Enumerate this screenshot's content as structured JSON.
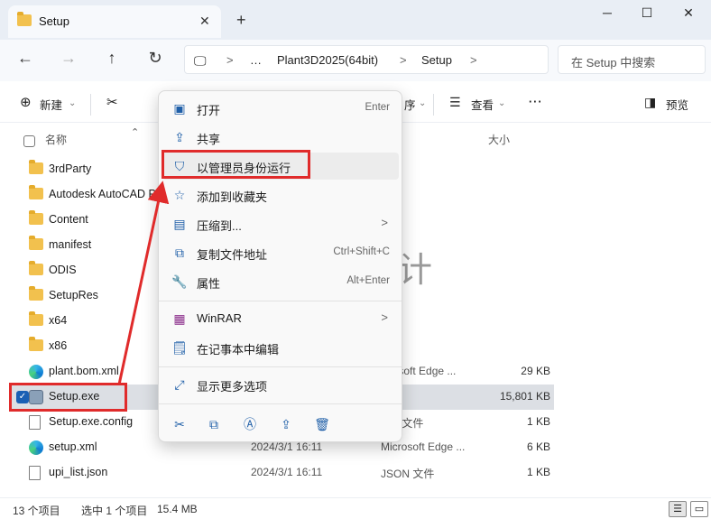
{
  "window": {
    "tab_title": "Setup",
    "new_tab": "+",
    "minimize": "─",
    "maximize": "☐",
    "close": "✕"
  },
  "address": {
    "parts": [
      "…",
      "Plant3D2025(64bit)",
      "Setup"
    ],
    "separator": ">",
    "search_placeholder": "在 Setup 中搜索"
  },
  "toolbar": {
    "new_label": "新建",
    "sort_label": "序",
    "view_label": "查看",
    "more_label": "···",
    "preview_label": "预览"
  },
  "columns": {
    "name": "名称",
    "size": "大小"
  },
  "files": [
    {
      "name": "3rdParty",
      "icon": "folder-icon",
      "date": "",
      "type": "夹",
      "size": ""
    },
    {
      "name": "Autodesk AutoCAD P",
      "icon": "folder-icon",
      "date": "",
      "type": "夹",
      "size": ""
    },
    {
      "name": "Content",
      "icon": "folder-icon",
      "date": "",
      "type": "夹",
      "size": ""
    },
    {
      "name": "manifest",
      "icon": "folder-icon",
      "date": "",
      "type": "夹",
      "size": ""
    },
    {
      "name": "ODIS",
      "icon": "folder-icon",
      "date": "",
      "type": "夹",
      "size": ""
    },
    {
      "name": "SetupRes",
      "icon": "folder-icon",
      "date": "",
      "type": "夹",
      "size": ""
    },
    {
      "name": "x64",
      "icon": "folder-icon",
      "date": "",
      "type": "夹",
      "size": ""
    },
    {
      "name": "x86",
      "icon": "folder-icon",
      "date": "",
      "type": "夹",
      "size": ""
    },
    {
      "name": "plant.bom.xml",
      "icon": "edge-icon",
      "date": "",
      "type": "icrosoft Edge ...",
      "size": "29 KB"
    },
    {
      "name": "Setup.exe",
      "icon": "exe-icon",
      "date": "",
      "type": "程序",
      "size": "15,801 KB"
    },
    {
      "name": "Setup.exe.config",
      "icon": "file-icon",
      "date": "",
      "type": "FIG 文件",
      "size": "1 KB"
    },
    {
      "name": "setup.xml",
      "icon": "edge-icon",
      "date": "2024/3/1 16:11",
      "type": "Microsoft Edge ...",
      "size": "6 KB"
    },
    {
      "name": "upi_list.json",
      "icon": "file-icon",
      "date": "2024/3/1 16:11",
      "type": "JSON 文件",
      "size": "1 KB"
    }
  ],
  "status": {
    "count": "13 个项目",
    "selected": "选中 1 个项目",
    "selected_size": "15.4 MB"
  },
  "context_menu": {
    "items": [
      {
        "label": "打开",
        "key": "Enter",
        "icon": "open-icon"
      },
      {
        "label": "共享",
        "key": "",
        "icon": "share-icon"
      },
      {
        "label": "以管理员身份运行",
        "key": "",
        "icon": "shield-icon"
      },
      {
        "label": "添加到收藏夹",
        "key": "",
        "icon": "star-icon"
      },
      {
        "label": "压缩到...",
        "key": "",
        "icon": "zip-icon",
        "submenu": ">"
      },
      {
        "label": "复制文件地址",
        "key": "Ctrl+Shift+C",
        "icon": "copy-path-icon"
      },
      {
        "label": "属性",
        "key": "Alt+Enter",
        "icon": "wrench-icon"
      },
      {
        "label": "WinRAR",
        "key": "",
        "icon": "winrar-icon",
        "submenu": ">"
      },
      {
        "label": "在记事本中编辑",
        "key": "",
        "icon": "notepad-icon"
      },
      {
        "label": "显示更多选项",
        "key": "",
        "icon": "more-options-icon"
      }
    ]
  },
  "watermark": "雨燊设计",
  "colors": {
    "accent": "#1a5fb4",
    "annotation": "#e02b2b",
    "folder": "#f2c14e"
  }
}
